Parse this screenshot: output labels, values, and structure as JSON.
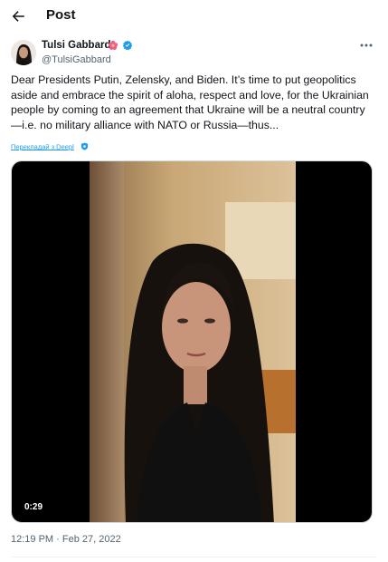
{
  "header": {
    "title": "Post",
    "back_icon": "arrow-left-icon"
  },
  "author": {
    "name": "Tulsi Gabbard",
    "handle": "@TulsiGabbard",
    "badge_icon": "hibiscus-flower-icon",
    "verified_color": "#1d9bf0"
  },
  "tweet": {
    "text_lines": [
      "Dear Presidents Putin, Zelensky, and Biden. It’s time to put geopolitics",
      "aside and embrace the spirit of aloha, respect and love, for the Ukrainian",
      "people by coming to an agreement that Ukraine will be a neutral country",
      "—i.e. no military alliance with NATO or Russia—thus..."
    ],
    "translate_label": "Перекладай з Deepl"
  },
  "video": {
    "duration": "0:29"
  },
  "meta": {
    "timestamp": "12:19 PM · Feb 27, 2022"
  },
  "colors": {
    "accent": "#1d9bf0",
    "secondary_text": "#536471"
  }
}
